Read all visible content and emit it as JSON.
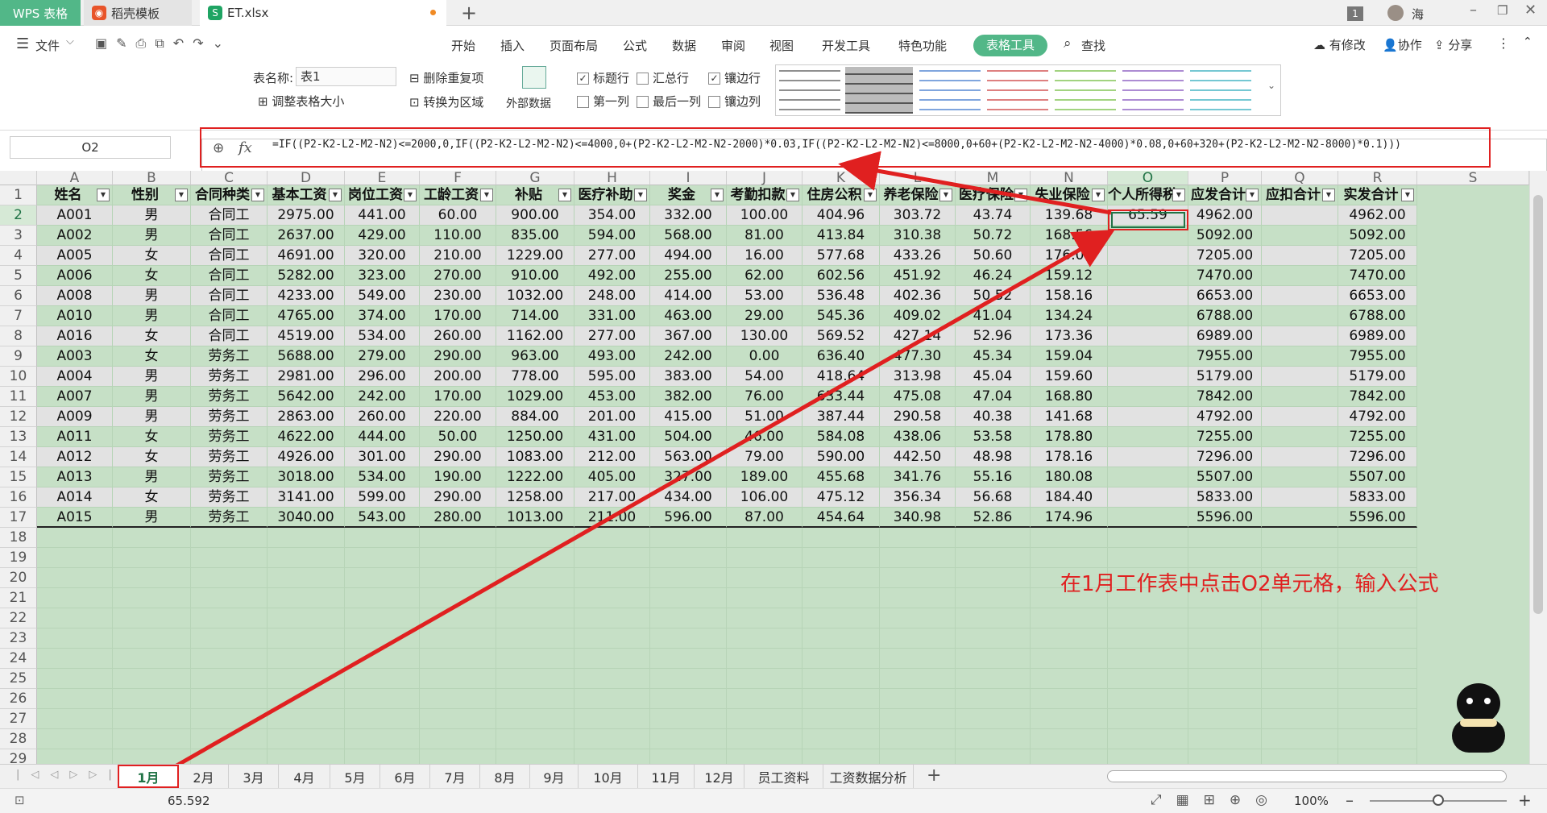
{
  "titlebar": {
    "tabs": [
      {
        "label": "WPS 表格"
      },
      {
        "label": "稻壳模板"
      },
      {
        "label": "ET.xlsx"
      }
    ],
    "badge": "1",
    "user": "海"
  },
  "menubar": {
    "file": "文件",
    "items": [
      "开始",
      "插入",
      "页面布局",
      "公式",
      "数据",
      "审阅",
      "视图",
      "开发工具",
      "特色功能",
      "表格工具"
    ],
    "search": "查找",
    "right": [
      "有修改",
      "协作",
      "分享"
    ]
  },
  "ribbon": {
    "table_name_label": "表名称:",
    "table_name_value": "表1",
    "resize": "调整表格大小",
    "remove_dup": "删除重复项",
    "to_range": "转换为区域",
    "external": "外部数据",
    "chk": [
      {
        "label": "标题行",
        "checked": true
      },
      {
        "label": "汇总行",
        "checked": false
      },
      {
        "label": "镶边行",
        "checked": true
      },
      {
        "label": "第一列",
        "checked": false
      },
      {
        "label": "最后一列",
        "checked": false
      },
      {
        "label": "镶边列",
        "checked": false
      }
    ]
  },
  "formula_bar": {
    "name_box": "O2",
    "fx": "fx",
    "formula": "=IF((P2-K2-L2-M2-N2)<=2000,0,IF((P2-K2-L2-M2-N2)<=4000,0+(P2-K2-L2-M2-N2-2000)*0.03,IF((P2-K2-L2-M2-N2)<=8000,0+60+(P2-K2-L2-M2-N2-4000)*0.08,0+60+320+(P2-K2-L2-M2-N2-8000)*0.1)))"
  },
  "grid": {
    "col_letters": [
      "A",
      "B",
      "C",
      "D",
      "E",
      "F",
      "G",
      "H",
      "I",
      "J",
      "K",
      "L",
      "M",
      "N",
      "O",
      "P",
      "Q",
      "R",
      "S"
    ],
    "headers": [
      "姓名",
      "性别",
      "合同种类",
      "基本工资",
      "岗位工资",
      "工龄工资",
      "补贴",
      "医疗补助",
      "奖金",
      "考勤扣款",
      "住房公积",
      "养老保险",
      "医疗保险",
      "失业保险",
      "个人所得税",
      "应发合计",
      "应扣合计",
      "实发合计"
    ],
    "rows": [
      [
        "A001",
        "男",
        "合同工",
        "2975.00",
        "441.00",
        "60.00",
        "900.00",
        "354.00",
        "332.00",
        "100.00",
        "404.96",
        "303.72",
        "43.74",
        "139.68",
        "65.59",
        "4962.00",
        "",
        "4962.00"
      ],
      [
        "A002",
        "男",
        "合同工",
        "2637.00",
        "429.00",
        "110.00",
        "835.00",
        "594.00",
        "568.00",
        "81.00",
        "413.84",
        "310.38",
        "50.72",
        "168.56",
        "",
        "5092.00",
        "",
        "5092.00"
      ],
      [
        "A005",
        "女",
        "合同工",
        "4691.00",
        "320.00",
        "210.00",
        "1229.00",
        "277.00",
        "494.00",
        "16.00",
        "577.68",
        "433.26",
        "50.60",
        "176.00",
        "",
        "7205.00",
        "",
        "7205.00"
      ],
      [
        "A006",
        "女",
        "合同工",
        "5282.00",
        "323.00",
        "270.00",
        "910.00",
        "492.00",
        "255.00",
        "62.00",
        "602.56",
        "451.92",
        "46.24",
        "159.12",
        "",
        "7470.00",
        "",
        "7470.00"
      ],
      [
        "A008",
        "男",
        "合同工",
        "4233.00",
        "549.00",
        "230.00",
        "1032.00",
        "248.00",
        "414.00",
        "53.00",
        "536.48",
        "402.36",
        "50.52",
        "158.16",
        "",
        "6653.00",
        "",
        "6653.00"
      ],
      [
        "A010",
        "男",
        "合同工",
        "4765.00",
        "374.00",
        "170.00",
        "714.00",
        "331.00",
        "463.00",
        "29.00",
        "545.36",
        "409.02",
        "41.04",
        "134.24",
        "",
        "6788.00",
        "",
        "6788.00"
      ],
      [
        "A016",
        "女",
        "合同工",
        "4519.00",
        "534.00",
        "260.00",
        "1162.00",
        "277.00",
        "367.00",
        "130.00",
        "569.52",
        "427.14",
        "52.96",
        "173.36",
        "",
        "6989.00",
        "",
        "6989.00"
      ],
      [
        "A003",
        "女",
        "劳务工",
        "5688.00",
        "279.00",
        "290.00",
        "963.00",
        "493.00",
        "242.00",
        "0.00",
        "636.40",
        "477.30",
        "45.34",
        "159.04",
        "",
        "7955.00",
        "",
        "7955.00"
      ],
      [
        "A004",
        "男",
        "劳务工",
        "2981.00",
        "296.00",
        "200.00",
        "778.00",
        "595.00",
        "383.00",
        "54.00",
        "418.64",
        "313.98",
        "45.04",
        "159.60",
        "",
        "5179.00",
        "",
        "5179.00"
      ],
      [
        "A007",
        "男",
        "劳务工",
        "5642.00",
        "242.00",
        "170.00",
        "1029.00",
        "453.00",
        "382.00",
        "76.00",
        "633.44",
        "475.08",
        "47.04",
        "168.80",
        "",
        "7842.00",
        "",
        "7842.00"
      ],
      [
        "A009",
        "男",
        "劳务工",
        "2863.00",
        "260.00",
        "220.00",
        "884.00",
        "201.00",
        "415.00",
        "51.00",
        "387.44",
        "290.58",
        "40.38",
        "141.68",
        "",
        "4792.00",
        "",
        "4792.00"
      ],
      [
        "A011",
        "女",
        "劳务工",
        "4622.00",
        "444.00",
        "50.00",
        "1250.00",
        "431.00",
        "504.00",
        "46.00",
        "584.08",
        "438.06",
        "53.58",
        "178.80",
        "",
        "7255.00",
        "",
        "7255.00"
      ],
      [
        "A012",
        "女",
        "劳务工",
        "4926.00",
        "301.00",
        "290.00",
        "1083.00",
        "212.00",
        "563.00",
        "79.00",
        "590.00",
        "442.50",
        "48.98",
        "178.16",
        "",
        "7296.00",
        "",
        "7296.00"
      ],
      [
        "A013",
        "男",
        "劳务工",
        "3018.00",
        "534.00",
        "190.00",
        "1222.00",
        "405.00",
        "327.00",
        "189.00",
        "455.68",
        "341.76",
        "55.16",
        "180.08",
        "",
        "5507.00",
        "",
        "5507.00"
      ],
      [
        "A014",
        "女",
        "劳务工",
        "3141.00",
        "599.00",
        "290.00",
        "1258.00",
        "217.00",
        "434.00",
        "106.00",
        "475.12",
        "356.34",
        "56.68",
        "184.40",
        "",
        "5833.00",
        "",
        "5833.00"
      ],
      [
        "A015",
        "男",
        "劳务工",
        "3040.00",
        "543.00",
        "280.00",
        "1013.00",
        "211.00",
        "596.00",
        "87.00",
        "454.64",
        "340.98",
        "52.86",
        "174.96",
        "",
        "5596.00",
        "",
        "5596.00"
      ]
    ]
  },
  "annotation": "在1月工作表中点击O2单元格，输入公式",
  "sheets": [
    "1月",
    "2月",
    "3月",
    "4月",
    "5月",
    "6月",
    "7月",
    "8月",
    "9月",
    "10月",
    "11月",
    "12月",
    "员工资料",
    "工资数据分析"
  ],
  "status": {
    "value": "65.592",
    "zoom": "100%"
  },
  "colors": {
    "accent": "#52b788",
    "grid_bg": "#c6e0c6",
    "row_alt": "#e2e2e2",
    "highlight": "#e02020"
  }
}
